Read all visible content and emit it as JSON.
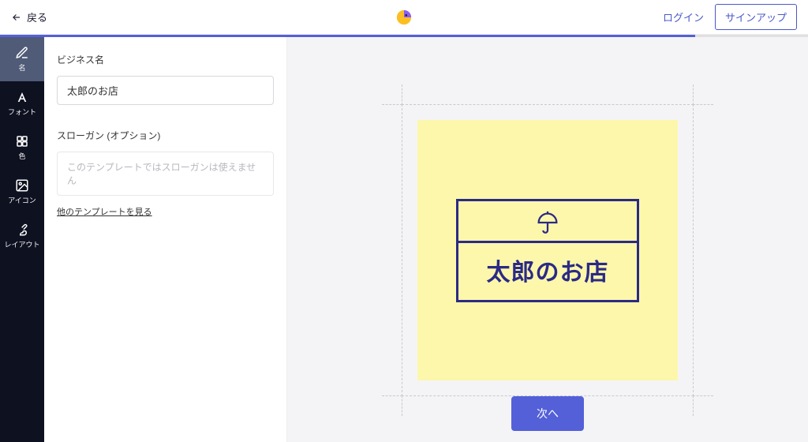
{
  "header": {
    "back_label": "戻る",
    "login_label": "ログイン",
    "signup_label": "サインアップ"
  },
  "sidebar": {
    "items": [
      {
        "label": "名"
      },
      {
        "label": "フォント"
      },
      {
        "label": "色"
      },
      {
        "label": "アイコン"
      },
      {
        "label": "レイアウト"
      }
    ]
  },
  "panel": {
    "business_name_label": "ビジネス名",
    "business_name_value": "太郎のお店",
    "slogan_label": "スローガン (オプション)",
    "slogan_placeholder": "このテンプレートではスローガンは使えません",
    "other_templates_link": "他のテンプレートを見る"
  },
  "preview": {
    "logo_text": "太郎のお店"
  },
  "footer": {
    "next_label": "次へ"
  },
  "colors": {
    "accent": "#5460d8",
    "logo_navy": "#2b2a86",
    "artboard": "#fcf7ab"
  }
}
